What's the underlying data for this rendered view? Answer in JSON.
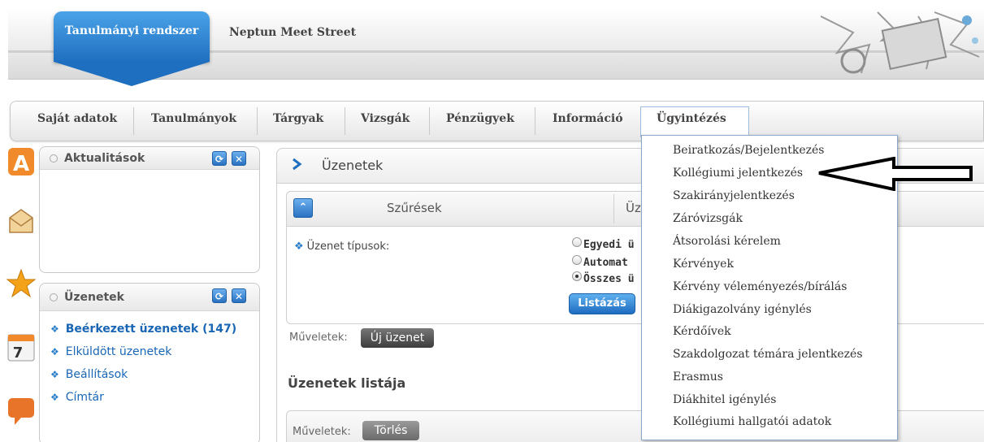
{
  "header": {
    "system_tab": "Tanulmányi rendszer",
    "app_name": "Neptun Meet Street"
  },
  "nav": {
    "items": [
      "Saját adatok",
      "Tanulmányok",
      "Tárgyak",
      "Vizsgák",
      "Pénzügyek",
      "Információ",
      "Ügyintézés"
    ],
    "active": "Ügyintézés"
  },
  "sidebar": {
    "icons": [
      "a-letter-icon",
      "envelope-icon",
      "star-icon",
      "calendar-icon",
      "speech-bubble-icon"
    ],
    "calendar_day": "7"
  },
  "news_box": {
    "title": "Aktualitások"
  },
  "messages_box": {
    "title": "Üzenetek",
    "links": [
      "Beérkezett üzenetek (147)",
      "Elküldött üzenetek",
      "Beállítások",
      "Címtár"
    ]
  },
  "content": {
    "title": "Üzenetek",
    "filter_title": "Szűrések",
    "filter_title2": "Üz",
    "msg_types_label": "Üzenet típusok:",
    "radio_options": [
      "Egyedi ü",
      "Automat",
      "Összes ü"
    ],
    "radio_selected": 2,
    "list_button": "Listázás",
    "ops_label": "Műveletek:",
    "new_message_button": "Új üzenet",
    "list_title": "Üzenetek listája",
    "ops_label2": "Műveletek:",
    "delete_button": "Törlés"
  },
  "dropdown": {
    "items": [
      "Beiratkozás/Bejelentkezés",
      "Kollégiumi jelentkezés",
      "Szakirányjelentkezés",
      "Záróvizsgák",
      "Átsorolási kérelem",
      "Kérvények",
      "Kérvény véleményezés/bírálás",
      "Diákigazolvány igénylés",
      "Kérdőívek",
      "Szakdolgozat témára jelentkezés",
      "Erasmus",
      "Diákhitel igénylés",
      "Kollégiumi hallgatói adatok"
    ]
  },
  "colors": {
    "accent_blue": "#1f6fc0",
    "link_blue": "#1a66b5",
    "nav_text": "#444444"
  }
}
